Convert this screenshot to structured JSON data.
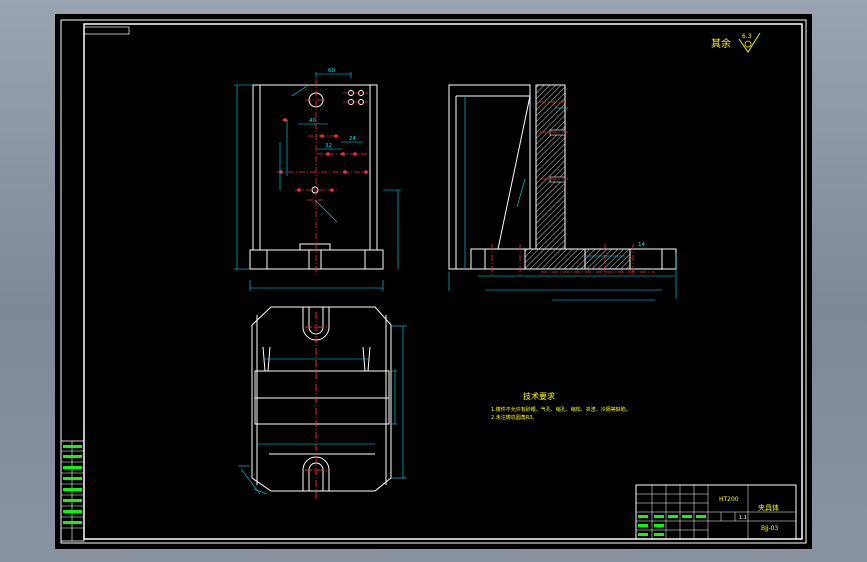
{
  "roughness": {
    "label": "其余",
    "value": "6.3"
  },
  "technical_requirements": {
    "title": "技术要求",
    "items": [
      "1.铸件不允许有砂眼、气孔、缩孔、缩松、夹渣、冷隔等缺陷。",
      "2.未注铸造圆角R3。"
    ]
  },
  "title_block": {
    "material": "HT200",
    "part_name": "夹具体",
    "drawing_no": "BJJ-03",
    "scale": "1:1"
  },
  "dimensions": {
    "d40": "40",
    "d32": "32",
    "d24": "24",
    "d14": "14",
    "top": "60"
  },
  "colors": {
    "background": "#000000",
    "outline": "#ffffff",
    "dimension": "#00e5ff",
    "centerline": "#ff2a2a",
    "hatch": "#ffffff",
    "note_text": "#ffff00",
    "legend_text": "#00ff00"
  }
}
